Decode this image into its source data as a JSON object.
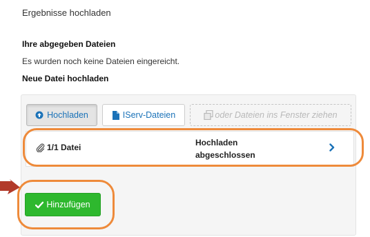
{
  "page": {
    "title": "Ergebnisse hochladen",
    "submitted_heading": "Ihre abgegeben Dateien",
    "no_files_text": "Es wurden noch keine Dateien eingereicht.",
    "new_file_heading": "Neue Datei hochladen"
  },
  "uploader": {
    "upload_label": "Hochladen",
    "iserv_label": "IServ-Dateien",
    "drop_label": "oder Dateien ins Fenster ziehen",
    "file_count": "1/1 Datei",
    "status": "Hochladen abgeschlossen",
    "add_label": "Hinzufügen"
  },
  "colors": {
    "accent_blue": "#1a72b8",
    "add_green": "#2eb82e",
    "annotation_orange": "#ee8a3a",
    "arrow_red": "#b23a2a"
  },
  "icons": [
    "upload-icon",
    "file-icon",
    "drop-file-icon",
    "paperclip-icon",
    "chevron-right-icon",
    "checkmark-icon",
    "annotation-arrow-icon"
  ]
}
